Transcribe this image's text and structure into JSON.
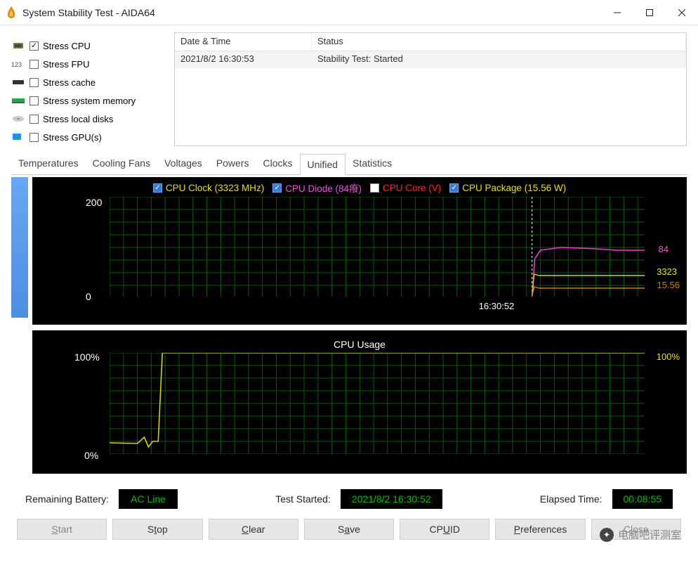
{
  "window": {
    "title": "System Stability Test - AIDA64"
  },
  "stress": {
    "items": [
      {
        "label": "Stress CPU",
        "checked": true
      },
      {
        "label": "Stress FPU",
        "checked": false
      },
      {
        "label": "Stress cache",
        "checked": false
      },
      {
        "label": "Stress system memory",
        "checked": false
      },
      {
        "label": "Stress local disks",
        "checked": false
      },
      {
        "label": "Stress GPU(s)",
        "checked": false
      }
    ]
  },
  "log": {
    "col1": "Date & Time",
    "col2": "Status",
    "row1_dt": "2021/8/2 16:30:53",
    "row1_status": "Stability Test: Started"
  },
  "tabs": [
    "Temperatures",
    "Cooling Fans",
    "Voltages",
    "Powers",
    "Clocks",
    "Unified",
    "Statistics"
  ],
  "active_tab": 5,
  "legend": {
    "clock": "CPU Clock (3323 MHz)",
    "diode": "CPU Diode (84癈)",
    "core": "CPU Core (V)",
    "pkg": "CPU Package (15.56 W)"
  },
  "upper_axis": {
    "ymax": "200",
    "ymin": "0",
    "xtick": "16:30:52",
    "r1": "84",
    "r2": "3323",
    "r3": "15.56"
  },
  "lower": {
    "title": "CPU Usage",
    "ymax": "100%",
    "ymin": "0%",
    "right": "100%"
  },
  "status": {
    "battery_label": "Remaining Battery:",
    "battery": "AC Line",
    "started_label": "Test Started:",
    "started": "2021/8/2 16:30:52",
    "elapsed_label": "Elapsed Time:",
    "elapsed": "00:08:55"
  },
  "buttons": {
    "start": "Start",
    "stop": "Stop",
    "clear": "Clear",
    "save": "Save",
    "cpuid": "CPUID",
    "pref": "Preferences",
    "close": "Close"
  },
  "watermark": "电脑吧评测室",
  "chart_data": [
    {
      "type": "line",
      "title": "Unified",
      "xlabel": "16:30:52",
      "ylim": [
        0,
        200
      ],
      "series": [
        {
          "name": "CPU Clock (MHz/100)",
          "color": "#d8d200",
          "points": [
            [
              0.79,
              0
            ],
            [
              0.8,
              44
            ],
            [
              0.82,
              42
            ],
            [
              0.88,
              42
            ],
            [
              1.0,
              42
            ]
          ],
          "value_label": "3323"
        },
        {
          "name": "CPU Diode (°C)",
          "color": "#ef3bd5",
          "points": [
            [
              0.79,
              0
            ],
            [
              0.8,
              76
            ],
            [
              0.81,
              92
            ],
            [
              0.86,
              98
            ],
            [
              0.92,
              94
            ],
            [
              1.0,
              93
            ]
          ],
          "value_label": "84"
        },
        {
          "name": "CPU Core (V)",
          "color": "#ff2020",
          "points": [],
          "value_label": ""
        },
        {
          "name": "CPU Package (W)",
          "color": "#c88000",
          "points": [
            [
              0.79,
              0
            ],
            [
              0.8,
              18
            ],
            [
              0.82,
              16
            ],
            [
              1.0,
              16
            ]
          ],
          "value_label": "15.56"
        }
      ]
    },
    {
      "type": "line",
      "title": "CPU Usage",
      "ylim": [
        0,
        100
      ],
      "series": [
        {
          "name": "CPU Usage %",
          "color": "#d8d200",
          "points": [
            [
              0.0,
              13
            ],
            [
              0.07,
              12
            ],
            [
              0.078,
              18
            ],
            [
              0.085,
              10
            ],
            [
              0.095,
              15
            ],
            [
              0.1,
              100
            ],
            [
              1.0,
              100
            ]
          ],
          "value_label": "100%"
        }
      ]
    }
  ]
}
